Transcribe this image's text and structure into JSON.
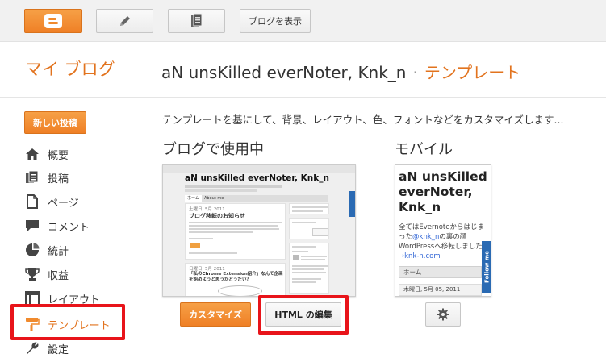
{
  "toolbar": {
    "view_blog_label": "ブログを表示"
  },
  "header": {
    "my_blogs": "マイ ブログ",
    "blog_name": "aN unsKilled everNoter, Knk_n",
    "separator": "·",
    "page": "テンプレート"
  },
  "sidebar": {
    "new_post_label": "新しい投稿",
    "items": [
      {
        "label": "概要",
        "icon": "home-icon"
      },
      {
        "label": "投稿",
        "icon": "posts-icon"
      },
      {
        "label": "ページ",
        "icon": "pages-icon"
      },
      {
        "label": "コメント",
        "icon": "comments-icon"
      },
      {
        "label": "統計",
        "icon": "stats-icon"
      },
      {
        "label": "収益",
        "icon": "trophy-icon"
      },
      {
        "label": "レイアウト",
        "icon": "layout-icon"
      },
      {
        "label": "テンプレート",
        "icon": "template-icon",
        "active": true
      },
      {
        "label": "設定",
        "icon": "wrench-icon"
      }
    ]
  },
  "main": {
    "description": "テンプレートを基にして、背景、レイアウト、色、フォントなどをカスタマイズします...",
    "in_use_title": "ブログで使用中",
    "mobile_title": "モバイル",
    "customize_label": "カスタマイズ",
    "edit_html_label": "HTML の編集"
  },
  "desktop_preview": {
    "title": "aN unsKilled everNoter, Knk_n",
    "tabs": [
      "ホーム",
      "About me"
    ],
    "post1_date": "土曜日, 5月 2011",
    "post1_title": "ブログ移転のお知らせ",
    "post2_date": "日曜日, 5月 2011",
    "post2_title": "「私のChrome Extension紹介」なんて企画を始めようと思うがどうだい？"
  },
  "mobile_preview": {
    "title": "aN unsKilled everNoter, Knk_n",
    "text_before": "全てはEvernoteからはじまった",
    "text_link": "@knk_n",
    "text_after": "の裏の顔 WordPressへ移転しました",
    "link": "→knk-n.com",
    "nav_label": "ホーム",
    "date": "木曜日, 5月 05, 2011",
    "follow_label": "Follow me"
  },
  "colors": {
    "accent": "#e2731e",
    "button_orange": "#ef8026",
    "highlight_red": "#e8141a"
  }
}
